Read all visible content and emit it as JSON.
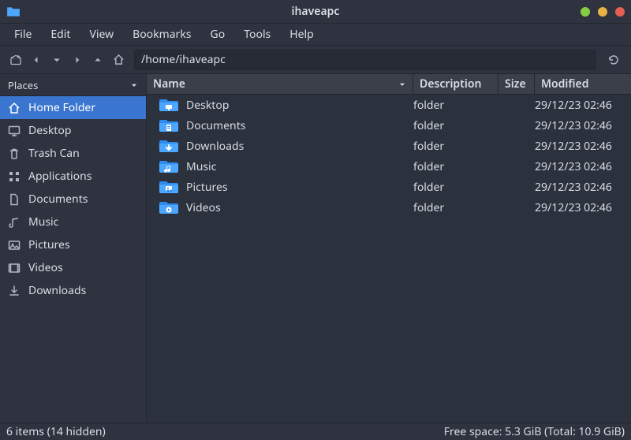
{
  "window": {
    "title": "ihaveapc"
  },
  "menu": {
    "items": [
      "File",
      "Edit",
      "View",
      "Bookmarks",
      "Go",
      "Tools",
      "Help"
    ]
  },
  "path": {
    "value": "/home/ihaveapc"
  },
  "sidebar": {
    "header": "Places",
    "items": [
      {
        "icon": "home",
        "label": "Home Folder",
        "selected": true
      },
      {
        "icon": "desktop",
        "label": "Desktop"
      },
      {
        "icon": "trash",
        "label": "Trash Can"
      },
      {
        "icon": "apps",
        "label": "Applications"
      },
      {
        "icon": "doc",
        "label": "Documents"
      },
      {
        "icon": "music",
        "label": "Music"
      },
      {
        "icon": "pictures",
        "label": "Pictures"
      },
      {
        "icon": "videos",
        "label": "Videos"
      },
      {
        "icon": "downloads",
        "label": "Downloads"
      }
    ]
  },
  "columns": {
    "name": "Name",
    "desc": "Description",
    "size": "Size",
    "mod": "Modified"
  },
  "files": [
    {
      "icon": "desktop",
      "name": "Desktop",
      "desc": "folder",
      "size": "",
      "mod": "29/12/23 02:46"
    },
    {
      "icon": "doc",
      "name": "Documents",
      "desc": "folder",
      "size": "",
      "mod": "29/12/23 02:46"
    },
    {
      "icon": "downloads",
      "name": "Downloads",
      "desc": "folder",
      "size": "",
      "mod": "29/12/23 02:46"
    },
    {
      "icon": "music",
      "name": "Music",
      "desc": "folder",
      "size": "",
      "mod": "29/12/23 02:46"
    },
    {
      "icon": "pictures",
      "name": "Pictures",
      "desc": "folder",
      "size": "",
      "mod": "29/12/23 02:46"
    },
    {
      "icon": "videos",
      "name": "Videos",
      "desc": "folder",
      "size": "",
      "mod": "29/12/23 02:46"
    }
  ],
  "status": {
    "left": "6 items (14 hidden)",
    "right": "Free space: 5.3 GiB (Total: 10.9 GiB)"
  }
}
